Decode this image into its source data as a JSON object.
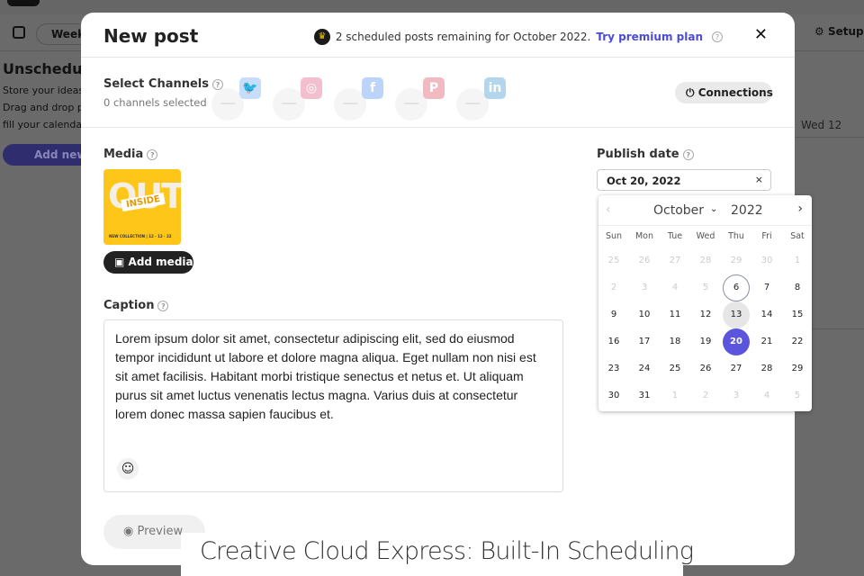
{
  "background": {
    "view_label": "Week",
    "setup_label": "Setup",
    "sidebar_title": "Unscheduled",
    "sidebar_lines": [
      "Store your ideas here.",
      "Drag and drop posts to",
      "fill your calendar."
    ],
    "add_new_label": "Add new",
    "day_label": "Wed 12"
  },
  "modal": {
    "title": "New post",
    "quota_prefix": "2 scheduled posts remaining for October 2022.",
    "premium_link": "Try premium plan",
    "help_glyph": "?",
    "close_glyph": "✕"
  },
  "channels": {
    "label": "Select Channels",
    "count": "0 channels selected",
    "items": [
      {
        "name": "Twitter",
        "glyph": "🐦",
        "color": "#c6ddfb"
      },
      {
        "name": "Instagram",
        "glyph": "◎",
        "color": "#f3bfcf"
      },
      {
        "name": "Facebook",
        "glyph": "f",
        "color": "#bcd3fa"
      },
      {
        "name": "Pinterest",
        "glyph": "P",
        "color": "#f1b9c0"
      },
      {
        "name": "LinkedIn",
        "glyph": "in",
        "color": "#b3d6ec"
      }
    ],
    "connections_label": "Connections"
  },
  "media": {
    "label": "Media",
    "thumb_title": "OUT",
    "thumb_badge": "INSIDE",
    "thumb_footer": "NEW COLLECTION | 12 · 12 · 22",
    "add_label": "Add media"
  },
  "caption": {
    "label": "Caption",
    "text": "Lorem ipsum dolor sit amet, consectetur adipiscing elit, sed do eiusmod tempor incididunt ut labore et dolore magna aliqua. Eget nullam non nisi est sit amet facilisis. Habitant morbi tristique senectus et netus et. Ut aliquam purus sit amet luctus venenatis lectus magna. Varius duis at consectetur lorem donec massa sapien faucibus et."
  },
  "preview_label": "Preview",
  "publish": {
    "label": "Publish date",
    "value": "Oct 20, 2022",
    "clear": "×"
  },
  "calendar": {
    "month": "October",
    "year": "2022",
    "weekdays": [
      "Sun",
      "Mon",
      "Tue",
      "Wed",
      "Thu",
      "Fri",
      "Sat"
    ],
    "weeks": [
      [
        "25",
        "26",
        "27",
        "28",
        "29",
        "30",
        "1"
      ],
      [
        "2",
        "3",
        "4",
        "5",
        "6",
        "7",
        "8"
      ],
      [
        "9",
        "10",
        "11",
        "12",
        "13",
        "14",
        "15"
      ],
      [
        "16",
        "17",
        "18",
        "19",
        "20",
        "21",
        "22"
      ],
      [
        "23",
        "24",
        "25",
        "26",
        "27",
        "28",
        "29"
      ],
      [
        "30",
        "31",
        "1",
        "2",
        "3",
        "4",
        "5"
      ]
    ],
    "muted": [
      [
        0,
        0
      ],
      [
        0,
        1
      ],
      [
        0,
        2
      ],
      [
        0,
        3
      ],
      [
        0,
        4
      ],
      [
        0,
        5
      ],
      [
        0,
        6
      ],
      [
        1,
        0
      ],
      [
        1,
        1
      ],
      [
        1,
        2
      ],
      [
        1,
        3
      ],
      [
        5,
        2
      ],
      [
        5,
        3
      ],
      [
        5,
        4
      ],
      [
        5,
        5
      ],
      [
        5,
        6
      ]
    ],
    "today": "6",
    "hovered": "13",
    "selected": "20",
    "accent": "#5b55dd"
  },
  "banner": "Creative Cloud Express: Built-In Scheduling"
}
